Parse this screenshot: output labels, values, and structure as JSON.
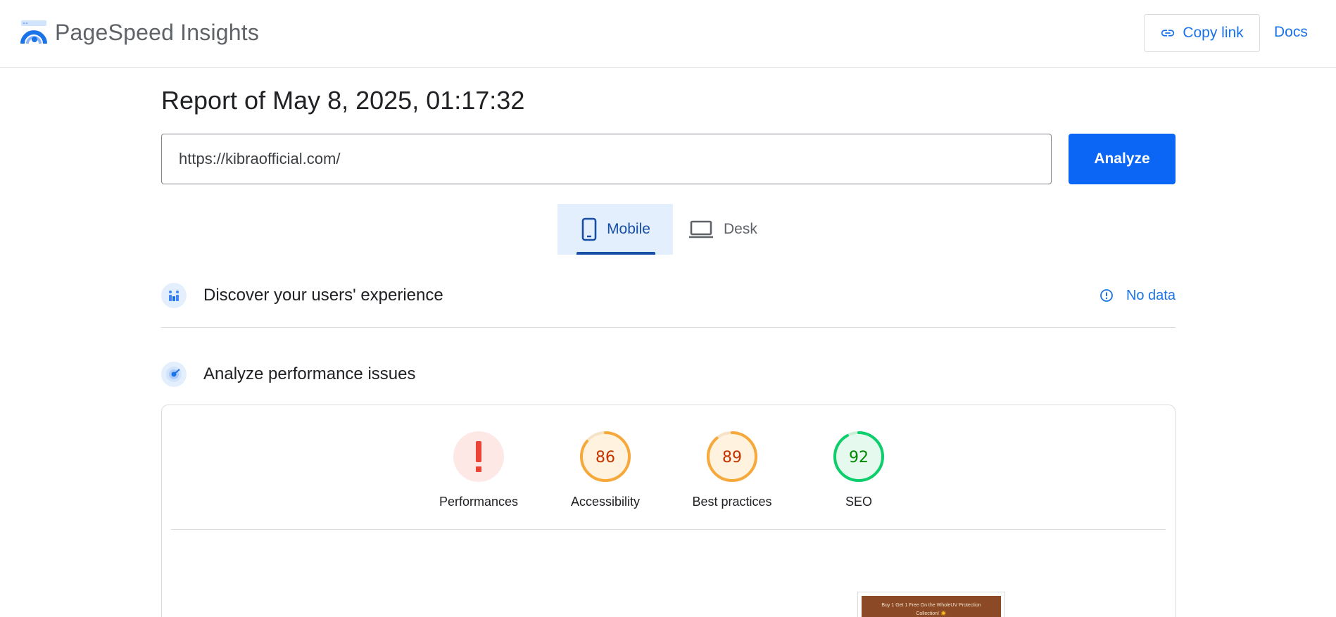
{
  "header": {
    "app_name": "PageSpeed Insights",
    "copy_link_label": "Copy link",
    "docs_label": "Docs"
  },
  "report": {
    "title": "Report of May 8, 2025, 01:17:32"
  },
  "search": {
    "url_value": "https://kibraofficial.com/",
    "analyze_label": "Analyze"
  },
  "tabs": {
    "mobile_label": "Mobile",
    "desktop_label": "Desk",
    "selected": "Mobile"
  },
  "sections": {
    "users_experience_title": "Discover your users' experience",
    "no_data_label": "No data",
    "performance_title": "Analyze performance issues"
  },
  "scores": [
    {
      "label": "Performances",
      "value": "!",
      "status": "error"
    },
    {
      "label": "Accessibility",
      "value": "86",
      "status": "average"
    },
    {
      "label": "Best practices",
      "value": "89",
      "status": "average"
    },
    {
      "label": "SEO",
      "value": "92",
      "status": "good"
    }
  ],
  "score_values": {
    "accessibility": 86,
    "best_practices": 89,
    "seo": 92
  },
  "screenshot_preview": {
    "text_line1": "Buy 1 Get 1 Free On the WholeUV Protection",
    "text_line2": "Collection! ☀️"
  },
  "colors": {
    "accent_blue": "#1a73e8",
    "analyze_button": "#0b65f5",
    "error_red": "#eb4335",
    "average_orange": "#f6a83a",
    "good_green": "#0cce6b"
  }
}
